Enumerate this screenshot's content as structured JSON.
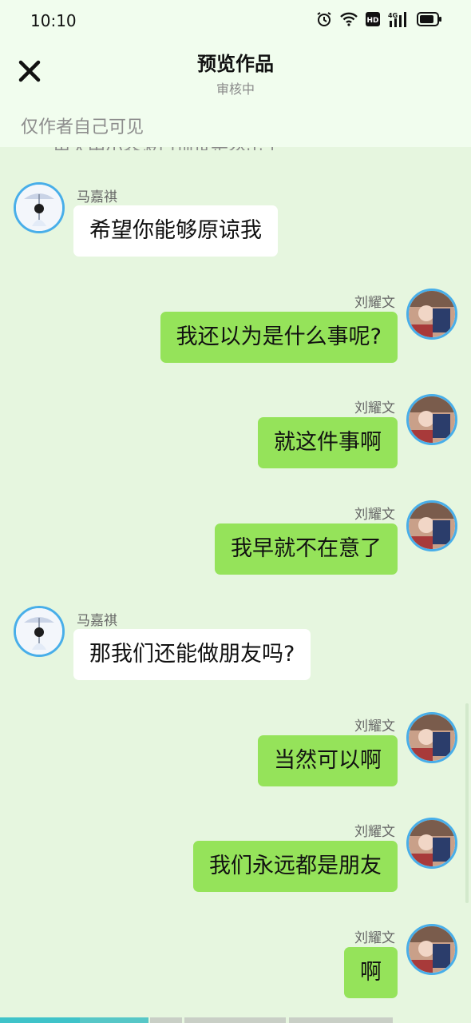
{
  "status_bar": {
    "time": "10:10",
    "icons": [
      "alarm-icon",
      "wifi-icon",
      "hd-icon",
      "signal-4g-icon",
      "battery-icon"
    ],
    "network_label": "4G"
  },
  "header": {
    "title": "预览作品",
    "subtitle": "审核中",
    "visibility_note": "仅作者自己可见",
    "close_icon": "close-icon"
  },
  "truncated_line": "用大中小界波口顶世是然出了",
  "messages": [
    {
      "side": "left",
      "sender": "马嘉祺",
      "text": "希望你能够原谅我"
    },
    {
      "side": "right",
      "sender": "刘耀文",
      "text": "我还以为是什么事呢?"
    },
    {
      "side": "right",
      "sender": "刘耀文",
      "text": "就这件事啊"
    },
    {
      "side": "right",
      "sender": "刘耀文",
      "text": "我早就不在意了"
    },
    {
      "side": "left",
      "sender": "马嘉祺",
      "text": "那我们还能做朋友吗?"
    },
    {
      "side": "right",
      "sender": "刘耀文",
      "text": "当然可以啊"
    },
    {
      "side": "right",
      "sender": "刘耀文",
      "text": "我们永远都是朋友"
    },
    {
      "side": "right",
      "sender": "刘耀文",
      "text": "啊"
    }
  ],
  "colors": {
    "background": "#e6f6df",
    "header_bg": "#f1fdee",
    "right_bubble": "#95e35a",
    "left_bubble": "#ffffff",
    "avatar_border": "#48aee9",
    "progress_teal": "#3fc3c9",
    "progress_gray": "#c9cfc6"
  }
}
